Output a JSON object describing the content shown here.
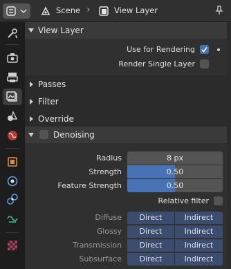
{
  "header": {
    "editor_type_icon": "properties-editor-icon",
    "breadcrumb": [
      {
        "icon": "scene-icon",
        "label": "Scene"
      },
      {
        "icon": "view-layer-icon",
        "label": "View Layer"
      }
    ],
    "pin_icon": "pin-icon"
  },
  "sidebar": {
    "tabs": [
      {
        "name": "tool",
        "icon": "tool-icon",
        "active": false
      },
      {
        "name": "render",
        "icon": "render-icon",
        "active": false
      },
      {
        "name": "output",
        "icon": "output-icon",
        "active": false
      },
      {
        "name": "view-layer",
        "icon": "view-layer-icon",
        "active": true
      },
      {
        "name": "scene",
        "icon": "scene-icon",
        "active": false
      },
      {
        "name": "world",
        "icon": "world-icon",
        "active": false
      },
      {
        "name": "object",
        "icon": "object-icon",
        "active": false
      },
      {
        "name": "modifiers",
        "icon": "wrench-icon",
        "active": false
      },
      {
        "name": "particles",
        "icon": "particles-icon",
        "active": false
      },
      {
        "name": "physics",
        "icon": "physics-icon",
        "active": false
      },
      {
        "name": "constraints",
        "icon": "constraints-icon",
        "active": false
      },
      {
        "name": "texture",
        "icon": "texture-icon",
        "active": false
      }
    ]
  },
  "view_layer_panel": {
    "title": "View Layer",
    "use_for_rendering": {
      "label": "Use for Rendering",
      "checked": true
    },
    "render_single_layer": {
      "label": "Render Single Layer",
      "checked": false
    }
  },
  "collapsed_panels": [
    "Passes",
    "Filter",
    "Override"
  ],
  "denoising_panel": {
    "title": "Denoising",
    "enabled": false,
    "radius": {
      "label": "Radius",
      "value": "8 px"
    },
    "strength": {
      "label": "Strength",
      "value": "0.50",
      "fraction": 0.5
    },
    "feature_strength": {
      "label": "Feature Strength",
      "value": "0.50",
      "fraction": 0.5
    },
    "relative_filter": {
      "label": "Relative filter",
      "checked": false
    },
    "passes": [
      {
        "label": "Diffuse",
        "direct": "Direct",
        "indirect": "Indirect"
      },
      {
        "label": "Glossy",
        "direct": "Direct",
        "indirect": "Indirect"
      },
      {
        "label": "Transmission",
        "direct": "Direct",
        "indirect": "Indirect"
      },
      {
        "label": "Subsurface",
        "direct": "Direct",
        "indirect": "Indirect"
      }
    ]
  },
  "colors": {
    "accent": "#4772b3",
    "pass_button": "#3b4c6e",
    "panel_bg": "#303030",
    "header_bg": "#3a3a3a"
  }
}
